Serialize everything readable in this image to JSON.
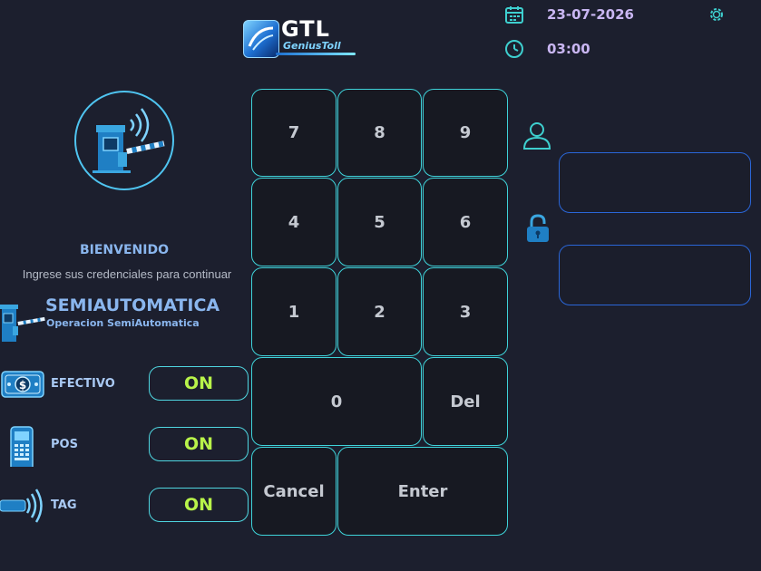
{
  "header": {
    "logo_title": "GTL",
    "logo_subtitle": "GeniusToll",
    "date": "23-07-2026",
    "time": "03:00"
  },
  "welcome": {
    "title": "BIENVENIDO",
    "subtitle": "Ingrese sus credenciales  para continuar"
  },
  "mode": {
    "title": "SEMIAUTOMATICA",
    "subtitle": "Operacion SemiAutomatica"
  },
  "payments": [
    {
      "label": "EFECTIVO",
      "status": "ON",
      "icon": "cash-icon"
    },
    {
      "label": "POS",
      "status": "ON",
      "icon": "pos-terminal-icon"
    },
    {
      "label": "TAG",
      "status": "ON",
      "icon": "tag-signal-icon"
    }
  ],
  "keypad": {
    "k7": "7",
    "k8": "8",
    "k9": "9",
    "k4": "4",
    "k5": "5",
    "k6": "6",
    "k1": "1",
    "k2": "2",
    "k3": "3",
    "k0": "0",
    "del": "Del",
    "cancel": "Cancel",
    "enter": "Enter"
  },
  "login": {
    "username_value": "",
    "password_value": ""
  },
  "colors": {
    "background": "#1c1f2e",
    "key_border": "#3ed3d9",
    "toggle_on_text": "#b8f34a",
    "accent_blue": "#8ab6ee",
    "date_text": "#c9b6f2",
    "field_border": "#2a66d8"
  }
}
